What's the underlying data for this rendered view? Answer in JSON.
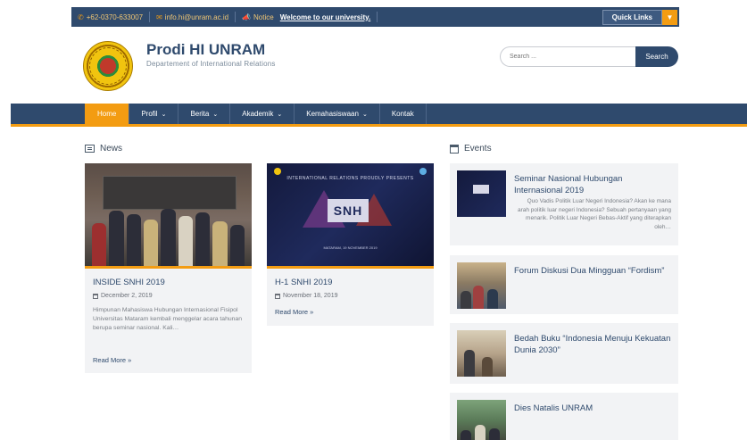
{
  "topbar": {
    "phone": "+62-0370-633007",
    "email": "info.hi@unram.ac.id",
    "notice_label": "Notice",
    "notice_text": "Welcome to our university.",
    "quick_links": "Quick Links"
  },
  "header": {
    "title": "Prodi HI UNRAM",
    "subtitle": "Departement of International Relations",
    "logo_text": "UNIVERSITAS MATARAM"
  },
  "search": {
    "placeholder": "Search ...",
    "button": "Search"
  },
  "nav": {
    "items": [
      {
        "label": "Home",
        "active": true
      },
      {
        "label": "Profil",
        "caret": "⌄"
      },
      {
        "label": "Berita",
        "caret": "⌄"
      },
      {
        "label": "Akademik",
        "caret": "⌄"
      },
      {
        "label": "Kemahasiswaan",
        "caret": "⌄"
      },
      {
        "label": "Kontak"
      }
    ]
  },
  "news": {
    "heading": "News",
    "cards": [
      {
        "title": "INSIDE SNHI 2019",
        "date": "December 2, 2019",
        "excerpt": "Himpunan Mahasiswa Hubungan Internasional Fisipol Universitas Mataram kembali menggelar acara tahunan berupa seminar nasional. Kali…",
        "more": "Read More »"
      },
      {
        "title": "H-1 SNHI 2019",
        "date": "November 18, 2019",
        "excerpt": "",
        "more": "Read More »",
        "image_heading": "INTERNATIONAL RELATIONS PROUDLY PRESENTS",
        "image_big": "SNH",
        "image_caption": "MATARAM, 19 NOVEMBER 2019"
      }
    ]
  },
  "events": {
    "heading": "Events",
    "items": [
      {
        "title": "Seminar Nasional Hubungan Internasional 2019",
        "excerpt": "Quo Vadis Politik Luar Negeri Indonesia? Akan ke mana arah politik luar negeri Indonesia? Sebuah pertanyaan yang menarik. Politik Luar Negeri Bebas-Aktif yang diterapkan oleh…"
      },
      {
        "title": "Forum Diskusi Dua Mingguan “Fordism”",
        "excerpt": ""
      },
      {
        "title": "Bedah Buku “Indonesia Menuju Kekuatan Dunia 2030”",
        "excerpt": ""
      },
      {
        "title": "Dies Natalis UNRAM",
        "excerpt": ""
      }
    ]
  },
  "colors": {
    "primary": "#2f4a6d",
    "accent": "#f39c12",
    "card_bg": "#f2f3f5"
  }
}
